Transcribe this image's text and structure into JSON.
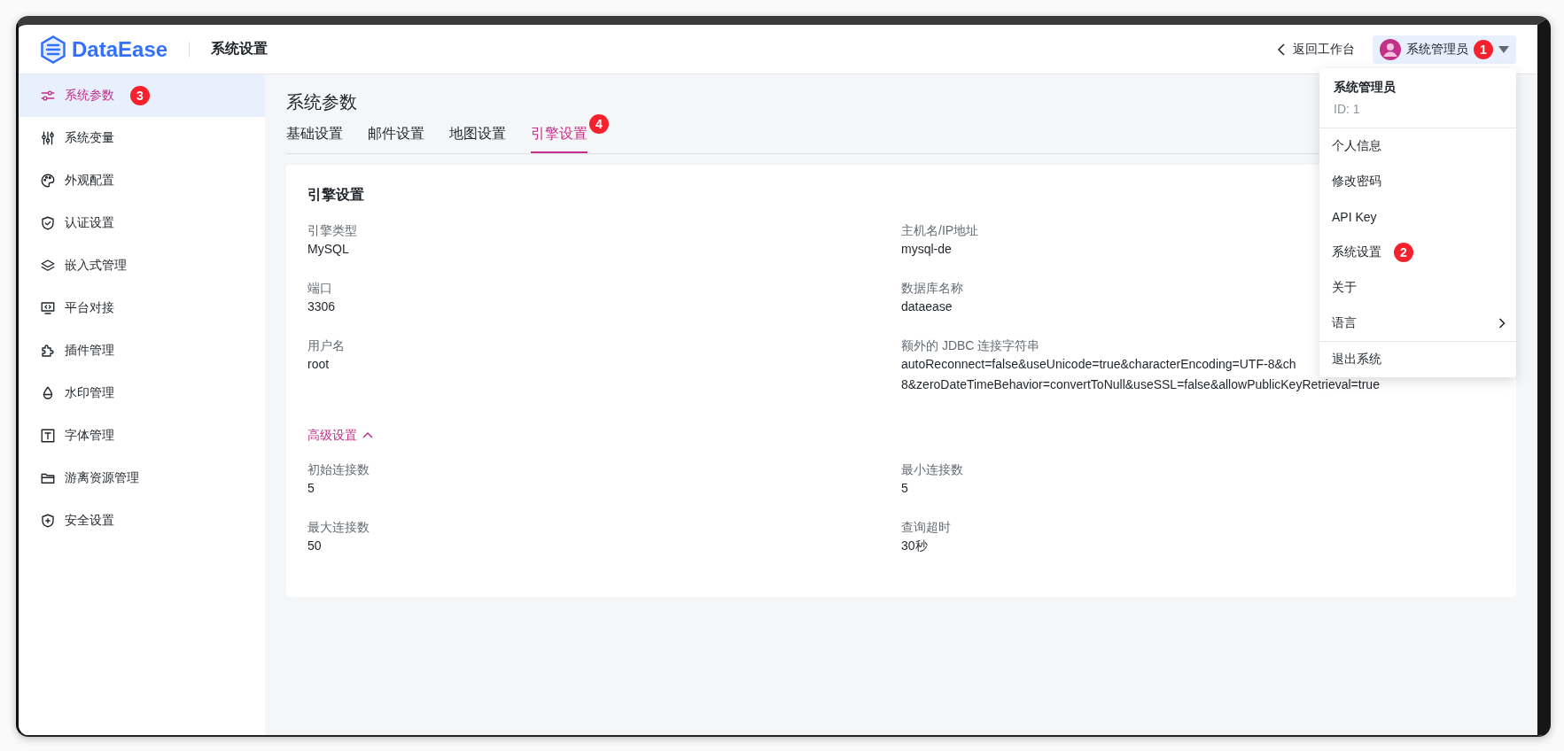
{
  "header": {
    "logo_text": "DataEase",
    "title": "系统设置",
    "back_link": "返回工作台",
    "user": {
      "name": "系统管理员",
      "badge": "1"
    }
  },
  "user_menu": {
    "name": "系统管理员",
    "id_label": "ID: 1",
    "sections": [
      {
        "items": [
          {
            "label": "个人信息",
            "kind": "item"
          },
          {
            "label": "修改密码",
            "kind": "item"
          },
          {
            "label": "API Key",
            "kind": "item"
          },
          {
            "label": "系统设置",
            "kind": "item",
            "badge": "2"
          },
          {
            "label": "关于",
            "kind": "item"
          },
          {
            "label": "语言",
            "kind": "submenu"
          }
        ]
      },
      {
        "items": [
          {
            "label": "退出系统",
            "kind": "item"
          }
        ]
      }
    ]
  },
  "sidebar": {
    "items": [
      {
        "label": "系统参数",
        "selected": true,
        "badge": "3"
      },
      {
        "label": "系统变量",
        "selected": false
      },
      {
        "label": "外观配置",
        "selected": false
      },
      {
        "label": "认证设置",
        "selected": false
      },
      {
        "label": "嵌入式管理",
        "selected": false
      },
      {
        "label": "平台对接",
        "selected": false
      },
      {
        "label": "插件管理",
        "selected": false
      },
      {
        "label": "水印管理",
        "selected": false
      },
      {
        "label": "字体管理",
        "selected": false
      },
      {
        "label": "游离资源管理",
        "selected": false
      },
      {
        "label": "安全设置",
        "selected": false
      }
    ]
  },
  "page": {
    "title": "系统参数",
    "tabs": [
      {
        "label": "基础设置",
        "selected": false
      },
      {
        "label": "邮件设置",
        "selected": false
      },
      {
        "label": "地图设置",
        "selected": false
      },
      {
        "label": "引擎设置",
        "selected": true,
        "badge": "4"
      }
    ],
    "card": {
      "title": "引擎设置",
      "fields": [
        {
          "label": "引擎类型",
          "lines": [
            "MySQL"
          ]
        },
        {
          "label": "主机名/IP地址",
          "lines": [
            "mysql-de"
          ]
        },
        {
          "label": "端口",
          "lines": [
            "3306"
          ]
        },
        {
          "label": "数据库名称",
          "lines": [
            "dataease"
          ]
        },
        {
          "label": "用户名",
          "lines": [
            "root"
          ]
        },
        {
          "label": "额外的 JDBC 连接字符串",
          "lines": [
            "autoReconnect=false&useUnicode=true&characterEncoding=UTF-8&ch",
            "8&zeroDateTimeBehavior=convertToNull&useSSL=false&allowPublicKeyRetrieval=true"
          ]
        }
      ],
      "advanced": {
        "label": "高级设置",
        "expanded": true,
        "fields": [
          {
            "label": "初始连接数",
            "lines": [
              "5"
            ]
          },
          {
            "label": "最小连接数",
            "lines": [
              "5"
            ]
          },
          {
            "label": "最大连接数",
            "lines": [
              "50"
            ]
          },
          {
            "label": "查询超时",
            "lines": [
              "30秒"
            ]
          }
        ]
      }
    }
  }
}
